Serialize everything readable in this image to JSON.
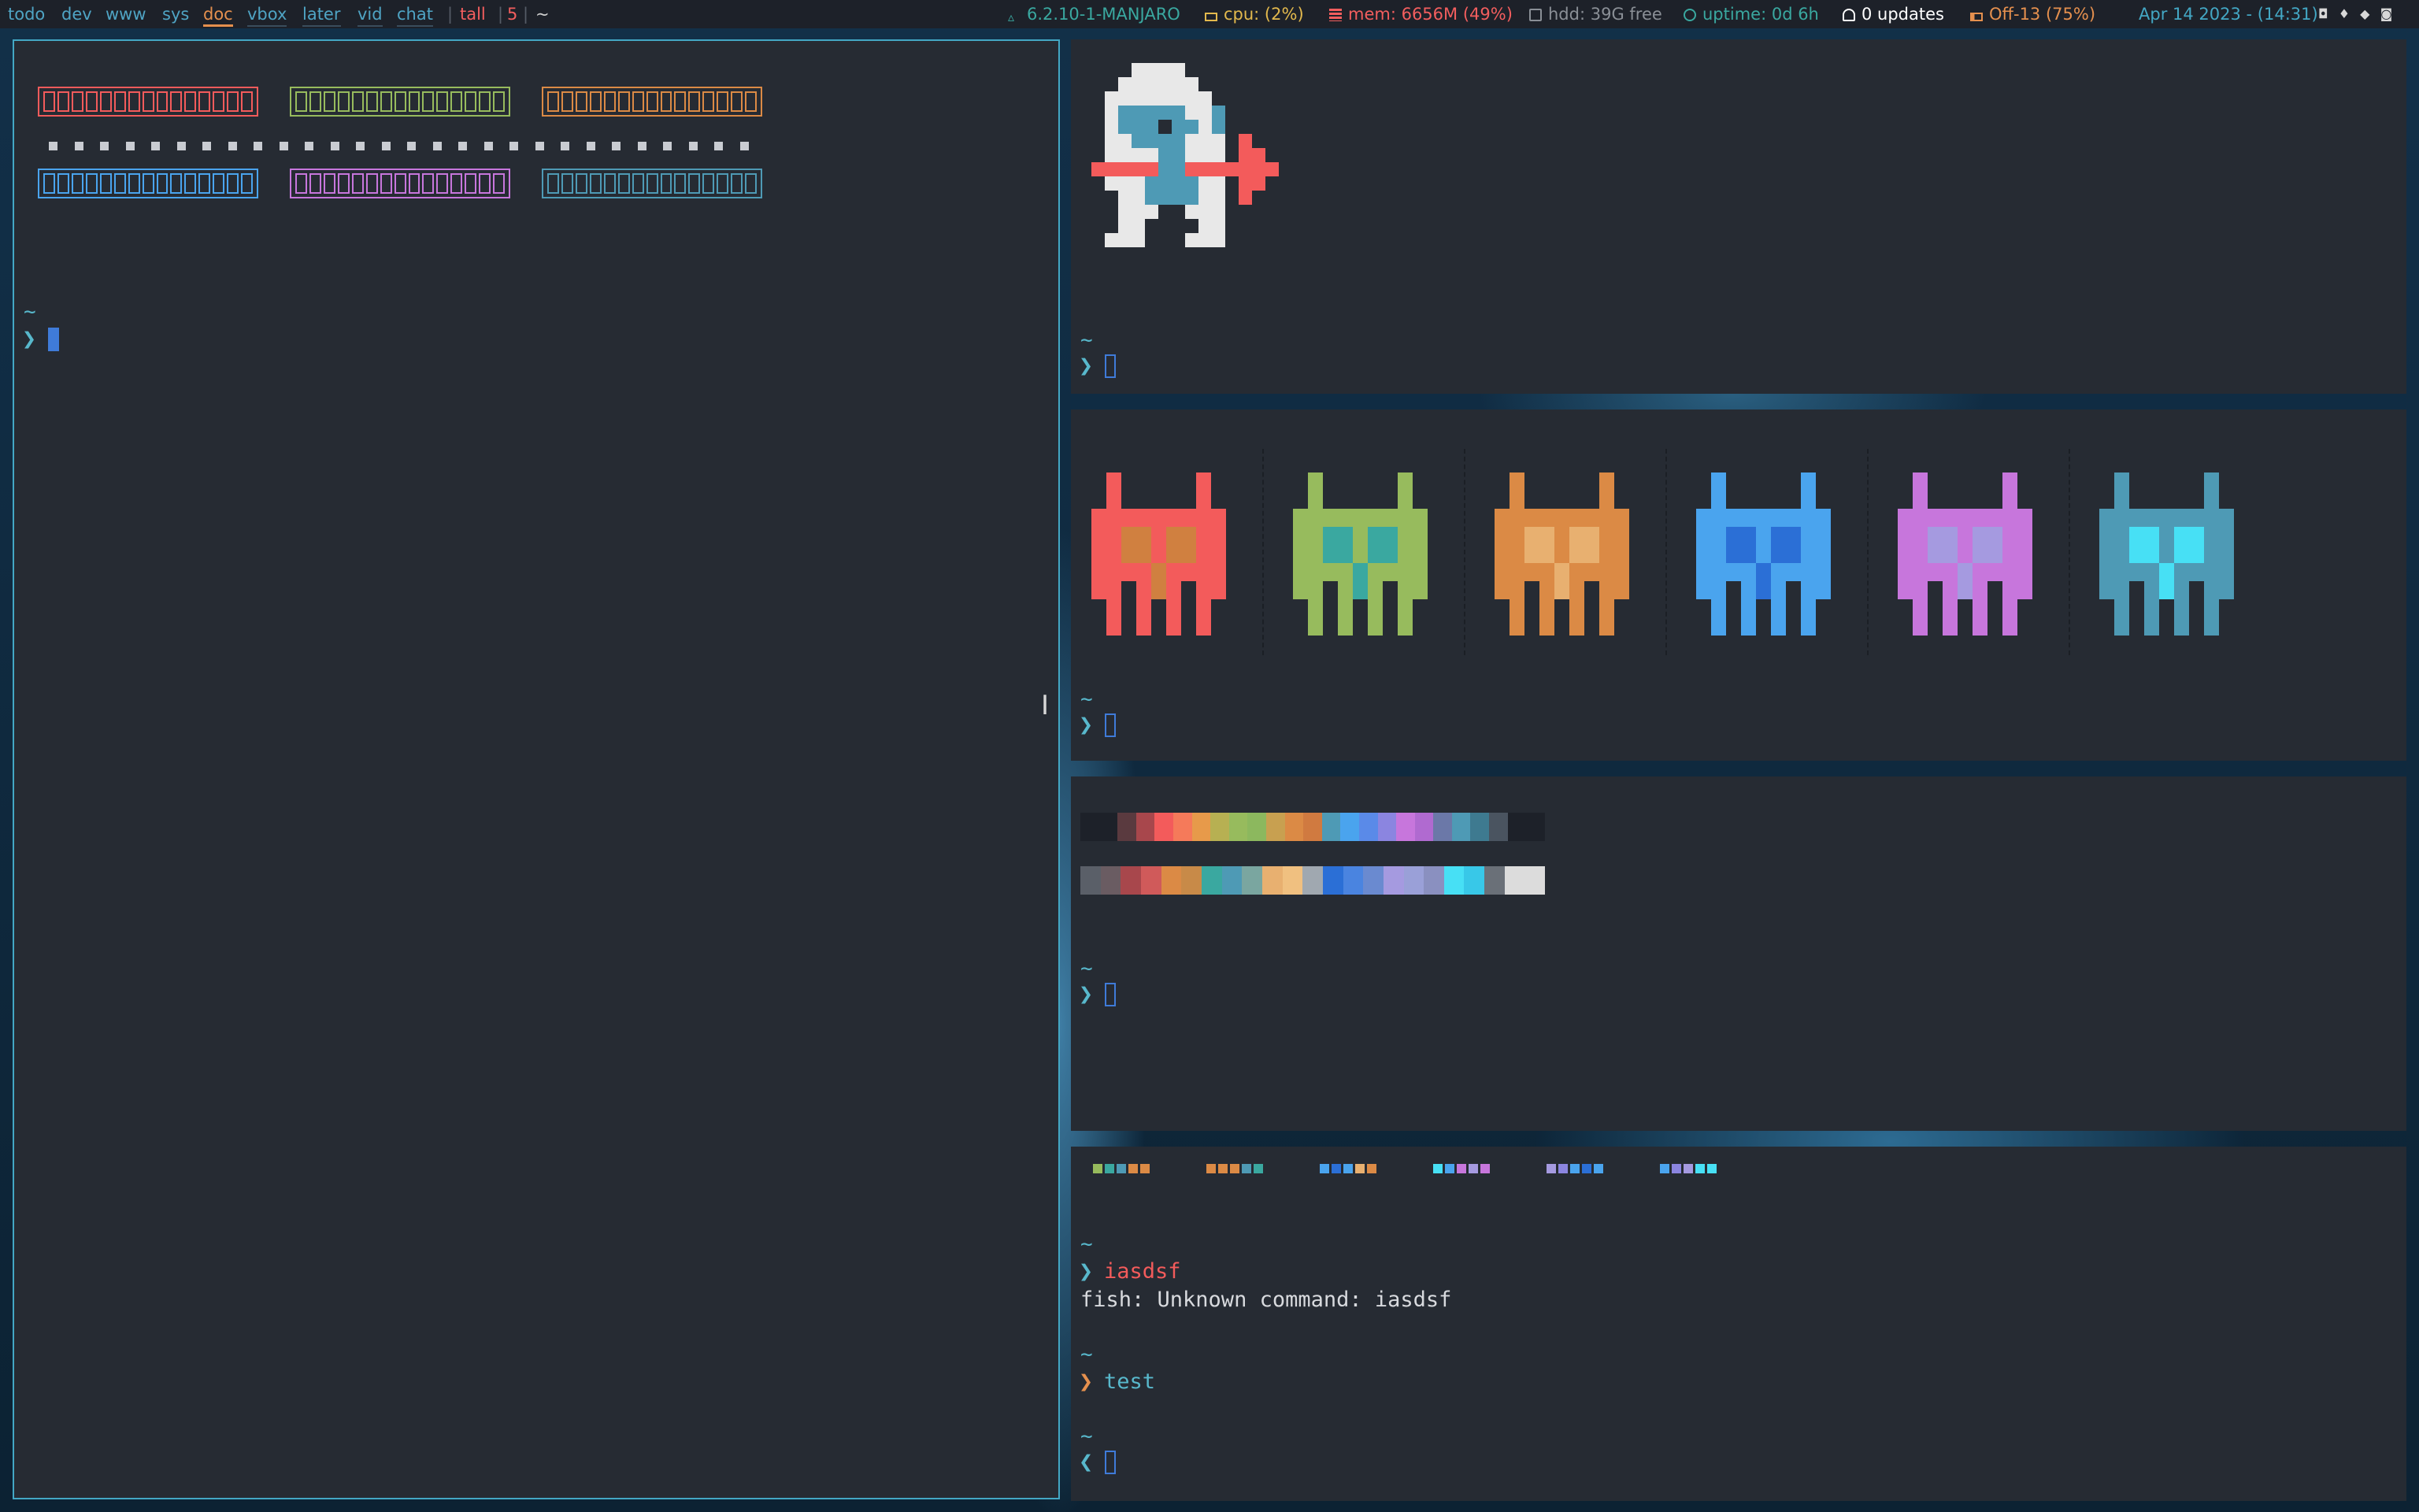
{
  "bar": {
    "workspaces": [
      "todo",
      "dev",
      "www",
      "sys",
      "doc",
      "vbox",
      "later",
      "vid",
      "chat"
    ],
    "active_workspace": "doc",
    "layout": "tall",
    "window_count": "5",
    "title": "~",
    "kernel": "6.2.10-1-MANJARO",
    "cpu": "cpu: (2%)",
    "mem": "mem: 6656M (49%)",
    "hdd": "hdd: 39G free",
    "uptime": "uptime: 0d 6h",
    "updates": "0 updates",
    "battery": "Off-13 (75%)",
    "clock": "Apr 14 2023 - (14:31)",
    "colors": {
      "accent": "#43a7c4",
      "orange": "#e5904e",
      "red": "#f35e5e",
      "green": "#3aa8a0"
    }
  },
  "terminals": {
    "tilde": "~",
    "arrow": "❯",
    "arrow_back": "❮",
    "cmd1": "iasdsf",
    "cmd1_error": "fish: Unknown command: iasdsf",
    "cmd2": "test"
  },
  "colors": {
    "red": "#f35b5b",
    "green": "#97bb5d",
    "orange": "#db8a45",
    "blue": "#4aa4ee",
    "magenta": "#c776dc",
    "cyan": "#4e9ab5",
    "background": "#262b33"
  },
  "icons": [
    "arch-icon",
    "monitor-icon",
    "memory-icon",
    "disk-icon",
    "uptime-icon",
    "bell-icon",
    "battery-icon",
    "tray-icons"
  ]
}
